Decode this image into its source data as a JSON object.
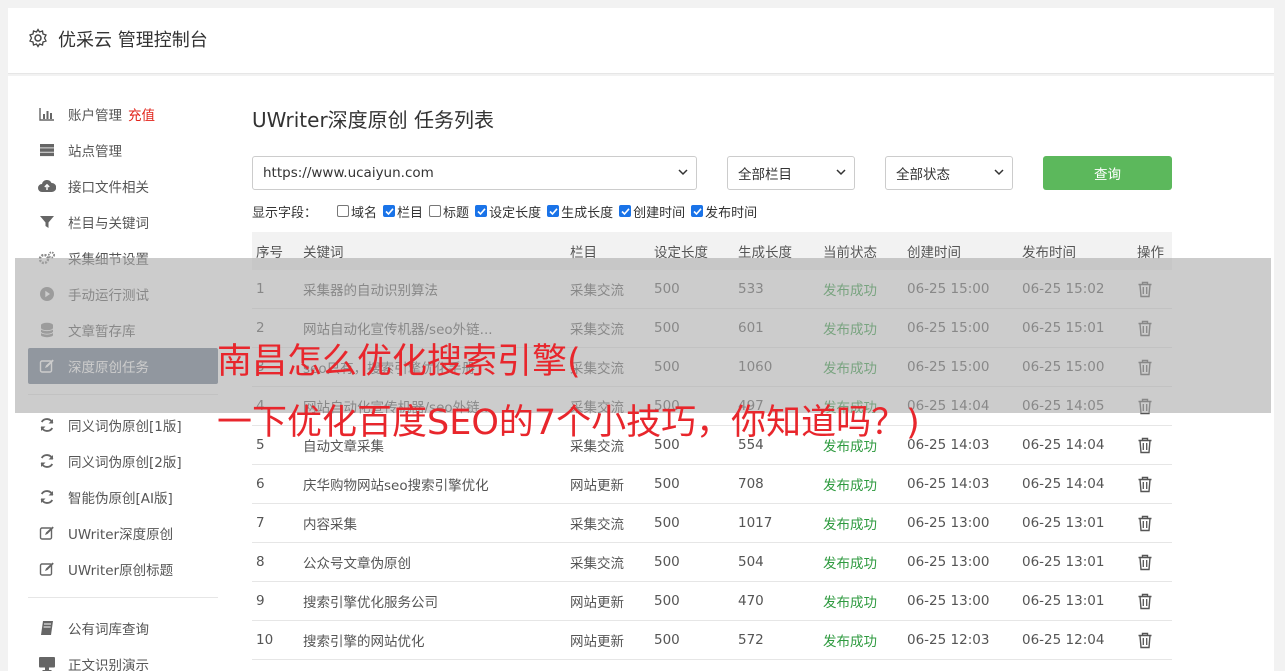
{
  "header": {
    "title": "优采云 管理控制台"
  },
  "sidebar": {
    "items": [
      {
        "label": "账户管理",
        "extra": "充值",
        "icon": "bar-chart-icon"
      },
      {
        "label": "站点管理",
        "icon": "server-icon"
      },
      {
        "label": "接口文件相关",
        "icon": "cloud-upload-icon"
      },
      {
        "label": "栏目与关键词",
        "icon": "filter-icon"
      },
      {
        "label": "采集细节设置",
        "icon": "gears-icon"
      },
      {
        "label": "手动运行测试",
        "icon": "play-icon"
      },
      {
        "label": "文章暂存库",
        "icon": "database-icon"
      },
      {
        "label": "深度原创任务",
        "icon": "edit-icon",
        "active": true
      }
    ],
    "items2": [
      {
        "label": "同义词伪原创[1版]",
        "icon": "refresh-icon"
      },
      {
        "label": "同义词伪原创[2版]",
        "icon": "refresh-icon"
      },
      {
        "label": "智能伪原创[AI版]",
        "icon": "refresh-icon"
      },
      {
        "label": "UWriter深度原创",
        "icon": "edit-icon"
      },
      {
        "label": "UWriter原创标题",
        "icon": "edit-icon"
      }
    ],
    "items3": [
      {
        "label": "公有词库查询",
        "icon": "book-icon"
      },
      {
        "label": "正文识别演示",
        "icon": "monitor-icon"
      }
    ]
  },
  "main": {
    "title": "UWriter深度原创 任务列表",
    "site_select": "https://www.ucaiyun.com",
    "column_select": "全部栏目",
    "status_select": "全部状态",
    "query_button": "查询",
    "fields_label": "显示字段：",
    "fields": [
      {
        "label": "域名",
        "checked": false
      },
      {
        "label": "栏目",
        "checked": true
      },
      {
        "label": "标题",
        "checked": false
      },
      {
        "label": "设定长度",
        "checked": true
      },
      {
        "label": "生成长度",
        "checked": true
      },
      {
        "label": "创建时间",
        "checked": true
      },
      {
        "label": "发布时间",
        "checked": true
      }
    ],
    "columns": [
      "序号",
      "关键词",
      "栏目",
      "设定长度",
      "生成长度",
      "当前状态",
      "创建时间",
      "发布时间",
      "操作"
    ],
    "rows": [
      [
        "1",
        "采集器的自动识别算法",
        "采集交流",
        "500",
        "533",
        "发布成功",
        "06-25 15:00",
        "06-25 15:02"
      ],
      [
        "2",
        "网站自动化宣传机器/seo外链...",
        "采集交流",
        "500",
        "601",
        "发布成功",
        "06-25 15:00",
        "06-25 15:01"
      ],
      [
        "3",
        "seo只有，搜索引擎优化手册",
        "采集交流",
        "500",
        "1060",
        "发布成功",
        "06-25 15:00",
        "06-25 15:00"
      ],
      [
        "4",
        "网站自动化宣传机器/seo外链...",
        "采集交流",
        "500",
        "497",
        "发布成功",
        "06-25 14:04",
        "06-25 14:05"
      ],
      [
        "5",
        "自动文章采集",
        "采集交流",
        "500",
        "554",
        "发布成功",
        "06-25 14:03",
        "06-25 14:04"
      ],
      [
        "6",
        "庆华购物网站seo搜索引擎优化",
        "网站更新",
        "500",
        "708",
        "发布成功",
        "06-25 14:03",
        "06-25 14:04"
      ],
      [
        "7",
        "内容采集",
        "采集交流",
        "500",
        "1017",
        "发布成功",
        "06-25 13:00",
        "06-25 13:01"
      ],
      [
        "8",
        "公众号文章伪原创",
        "采集交流",
        "500",
        "504",
        "发布成功",
        "06-25 13:00",
        "06-25 13:01"
      ],
      [
        "9",
        "搜索引擎优化服务公司",
        "网站更新",
        "500",
        "470",
        "发布成功",
        "06-25 13:00",
        "06-25 13:01"
      ],
      [
        "10",
        "搜索引擎的网站优化",
        "网站更新",
        "500",
        "572",
        "发布成功",
        "06-25 12:03",
        "06-25 12:04"
      ]
    ]
  },
  "watermark": {
    "line1": "南昌怎么优化搜索引擎(",
    "line2": "一下优化百度SEO的7个小技巧，你知道吗？)"
  }
}
